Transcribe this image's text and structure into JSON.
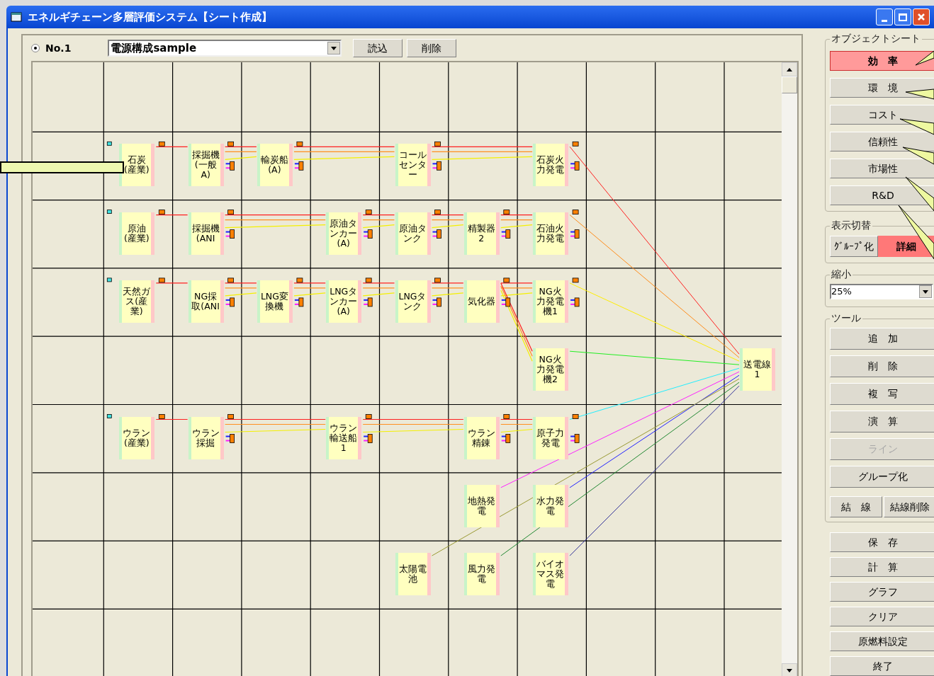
{
  "window": {
    "title": "エネルギチェーン多層評価システム【シート作成】"
  },
  "sheet_selector": {
    "radio": {
      "label": "No.1",
      "selected": true
    },
    "combo_value": "電源構成sample",
    "buttons": [
      "読込",
      "削除"
    ]
  },
  "diagram": {
    "nodes": [
      {
        "label": "石炭(産業)"
      },
      {
        "label": "採掘機(一般A)"
      },
      {
        "label": "輸炭船(A)"
      },
      {
        "label": "コールセンター"
      },
      {
        "label": "石炭火力発電"
      },
      {
        "label": "原油(産業)"
      },
      {
        "label": "採掘機(ANI"
      },
      {
        "label": "原油タンカー(A)"
      },
      {
        "label": "原油タンク"
      },
      {
        "label": "精製器2"
      },
      {
        "label": "石油火力発電"
      },
      {
        "label": "天然ガス(産業)"
      },
      {
        "label": "NG採取(ANI"
      },
      {
        "label": "LNG変換機"
      },
      {
        "label": "LNGタンカー(A)"
      },
      {
        "label": "LNGタンク"
      },
      {
        "label": "気化器"
      },
      {
        "label": "NG火力発電機1"
      },
      {
        "label": "NG火力発電機2"
      },
      {
        "label": "送電線1"
      },
      {
        "label": "ウラン(産業)"
      },
      {
        "label": "ウラン採掘"
      },
      {
        "label": "ウラン輸送船1"
      },
      {
        "label": "ウラン精錬"
      },
      {
        "label": "原子力発電"
      },
      {
        "label": "地熱発電"
      },
      {
        "label": "水力発電"
      },
      {
        "label": "太陽電池"
      },
      {
        "label": "風力発電"
      },
      {
        "label": "バイオマス発電"
      }
    ]
  },
  "object_sheet": {
    "title": "オブジェクトシート",
    "buttons": [
      {
        "label": "効　率",
        "selected": true
      },
      {
        "label": "環　境",
        "selected": false
      },
      {
        "label": "コスト",
        "selected": false
      },
      {
        "label": "信頼性",
        "selected": false
      },
      {
        "label": "市場性",
        "selected": false
      },
      {
        "label": "R&D",
        "selected": false
      }
    ]
  },
  "display_toggle": {
    "title": "表示切替",
    "options": [
      {
        "label": "ｸﾞﾙｰﾌﾟ化",
        "selected": false
      },
      {
        "label": "詳細",
        "selected": true
      }
    ]
  },
  "zoom": {
    "title": "縮小",
    "value": "25%"
  },
  "tools": {
    "title": "ツール",
    "buttons": [
      {
        "label": "追　加",
        "disabled": false
      },
      {
        "label": "削　除",
        "disabled": false
      },
      {
        "label": "複　写",
        "disabled": false
      },
      {
        "label": "演　算",
        "disabled": false
      },
      {
        "label": "ライン",
        "disabled": true
      },
      {
        "label": "グループ化",
        "disabled": false
      }
    ],
    "pair": [
      "結　線",
      "結線削除"
    ]
  },
  "actions": [
    "保　存",
    "計　算",
    "グラフ",
    "クリア",
    "原燃料設定",
    "終了"
  ]
}
